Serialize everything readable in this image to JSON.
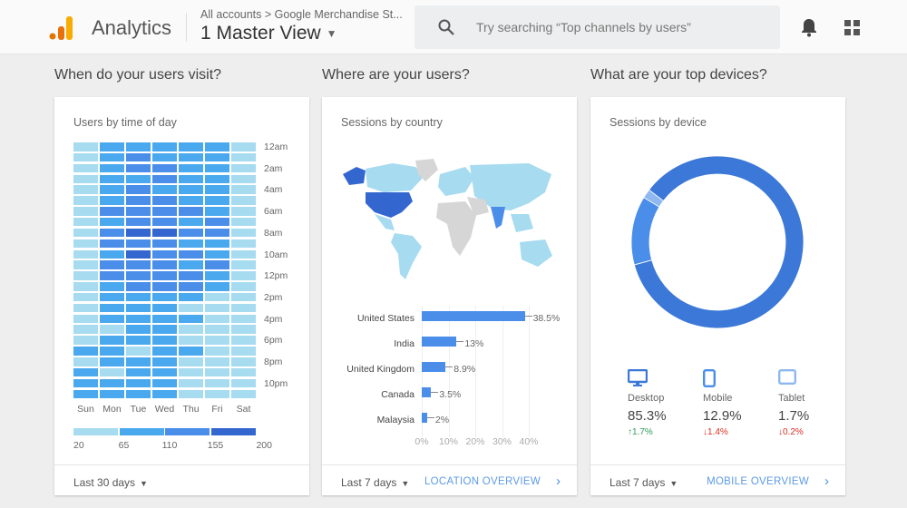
{
  "header": {
    "app_name": "Analytics",
    "breadcrumb": "All accounts > Google Merchandise St...",
    "view": "1 Master View",
    "search_placeholder": "Try searching “Top channels by users”"
  },
  "sections": [
    {
      "title": "When do your users visit?",
      "card_title": "Users by time of day",
      "range": "Last 30 days"
    },
    {
      "title": "Where are your users?",
      "card_title": "Sessions by country",
      "range": "Last 7 days",
      "link": "LOCATION OVERVIEW"
    },
    {
      "title": "What are your top devices?",
      "card_title": "Sessions by device",
      "range": "Last 7 days",
      "link": "MOBILE OVERVIEW"
    }
  ],
  "colors": {
    "level1": "#a6dbf0",
    "level2": "#4aa9ee",
    "level3": "#4a8eea",
    "level4": "#3466d0",
    "bar": "#4a8eea",
    "up": "#2e9e5b",
    "down": "#d93025"
  },
  "chart_data": [
    {
      "type": "heatmap",
      "title": "Users by time of day",
      "x": [
        "Sun",
        "Mon",
        "Tue",
        "Wed",
        "Thu",
        "Fri",
        "Sat"
      ],
      "y_labels": [
        "12am",
        "2am",
        "4am",
        "6am",
        "8am",
        "10am",
        "12pm",
        "2pm",
        "4pm",
        "6pm",
        "8pm",
        "10pm"
      ],
      "legend": [
        "20",
        "65",
        "110",
        "155",
        "200"
      ],
      "levels": [
        [
          1,
          2,
          2,
          2,
          2,
          2,
          1
        ],
        [
          1,
          2,
          3,
          2,
          2,
          2,
          1
        ],
        [
          1,
          2,
          3,
          3,
          2,
          2,
          1
        ],
        [
          1,
          2,
          2,
          3,
          2,
          2,
          1
        ],
        [
          1,
          2,
          3,
          2,
          2,
          2,
          1
        ],
        [
          1,
          2,
          3,
          3,
          2,
          2,
          1
        ],
        [
          1,
          3,
          3,
          3,
          3,
          2,
          1
        ],
        [
          1,
          2,
          3,
          3,
          2,
          3,
          1
        ],
        [
          1,
          3,
          4,
          4,
          3,
          3,
          1
        ],
        [
          1,
          3,
          3,
          3,
          2,
          2,
          1
        ],
        [
          1,
          2,
          4,
          3,
          3,
          2,
          1
        ],
        [
          1,
          3,
          3,
          3,
          2,
          3,
          1
        ],
        [
          1,
          3,
          3,
          3,
          3,
          2,
          1
        ],
        [
          1,
          2,
          3,
          3,
          3,
          2,
          1
        ],
        [
          1,
          2,
          2,
          2,
          2,
          1,
          1
        ],
        [
          1,
          2,
          2,
          2,
          1,
          1,
          1
        ],
        [
          1,
          2,
          2,
          2,
          2,
          1,
          1
        ],
        [
          1,
          1,
          2,
          2,
          1,
          1,
          1
        ],
        [
          1,
          2,
          2,
          2,
          1,
          1,
          1
        ],
        [
          2,
          2,
          1,
          2,
          2,
          1,
          1
        ],
        [
          1,
          2,
          2,
          2,
          1,
          1,
          1
        ],
        [
          2,
          1,
          2,
          2,
          1,
          1,
          1
        ],
        [
          2,
          2,
          2,
          2,
          1,
          1,
          1
        ],
        [
          2,
          2,
          2,
          2,
          1,
          1,
          1
        ]
      ]
    },
    {
      "type": "bar",
      "title": "Sessions by country",
      "categories": [
        "United States",
        "India",
        "United Kingdom",
        "Canada",
        "Malaysia"
      ],
      "values": [
        38.5,
        13,
        8.9,
        3.5,
        2
      ],
      "labels": [
        "38.5%",
        "13%",
        "8.9%",
        "3.5%",
        "2%"
      ],
      "ticks": [
        "0%",
        "10%",
        "20%",
        "30%",
        "40%"
      ],
      "xlim": [
        0,
        40
      ]
    },
    {
      "type": "pie",
      "title": "Sessions by device",
      "categories": [
        "Desktop",
        "Mobile",
        "Tablet"
      ],
      "values": [
        85.3,
        12.9,
        1.7
      ],
      "labels": [
        "85.3%",
        "12.9%",
        "1.7%"
      ],
      "changes": [
        "1.7%",
        "1.4%",
        "0.2%"
      ],
      "change_dir": [
        "up",
        "down",
        "down"
      ],
      "colors": [
        "#3c78d8",
        "#4a8eea",
        "#8fb8f0"
      ]
    }
  ]
}
